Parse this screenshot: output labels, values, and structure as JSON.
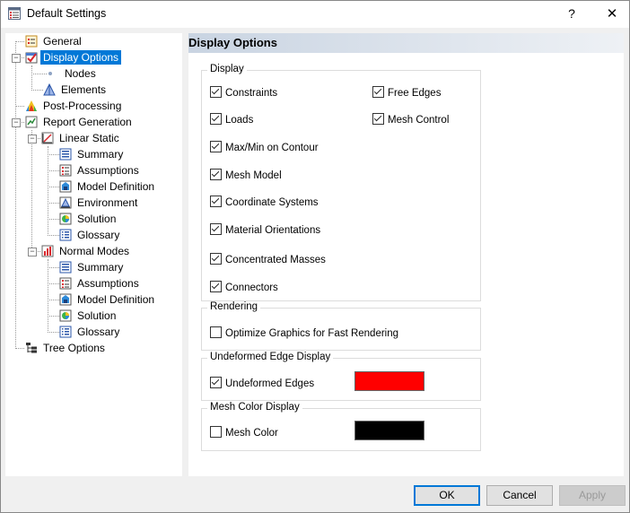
{
  "window": {
    "title": "Default Settings",
    "help": "?",
    "close": "✕"
  },
  "tree": {
    "general": "General",
    "display_options": "Display Options",
    "nodes": "Nodes",
    "elements": "Elements",
    "post_processing": "Post-Processing",
    "report_generation": "Report Generation",
    "linear_static": "Linear Static",
    "ls_summary": "Summary",
    "ls_assumptions": "Assumptions",
    "ls_model_definition": "Model Definition",
    "ls_environment": "Environment",
    "ls_solution": "Solution",
    "ls_glossary": "Glossary",
    "normal_modes": "Normal Modes",
    "nm_summary": "Summary",
    "nm_assumptions": "Assumptions",
    "nm_model_definition": "Model Definition",
    "nm_solution": "Solution",
    "nm_glossary": "Glossary",
    "tree_options": "Tree Options"
  },
  "panel": {
    "title": "Display Options",
    "display": {
      "label": "Display",
      "constraints": "Constraints",
      "loads": "Loads",
      "maxmin": "Max/Min on Contour",
      "mesh_model": "Mesh Model",
      "coordinate_systems": "Coordinate Systems",
      "material_orientations": "Material Orientations",
      "concentrated_masses": "Concentrated Masses",
      "connectors": "Connectors",
      "free_edges": "Free Edges",
      "mesh_control": "Mesh Control"
    },
    "rendering": {
      "label": "Rendering",
      "optimize": "Optimize Graphics for Fast Rendering"
    },
    "undeformed": {
      "label": "Undeformed Edge Display",
      "edges": "Undeformed Edges",
      "color": "#ff0000"
    },
    "mesh_color": {
      "label": "Mesh Color Display",
      "checkbox": "Mesh Color",
      "color": "#000000"
    }
  },
  "buttons": {
    "ok": "OK",
    "cancel": "Cancel",
    "apply": "Apply"
  }
}
